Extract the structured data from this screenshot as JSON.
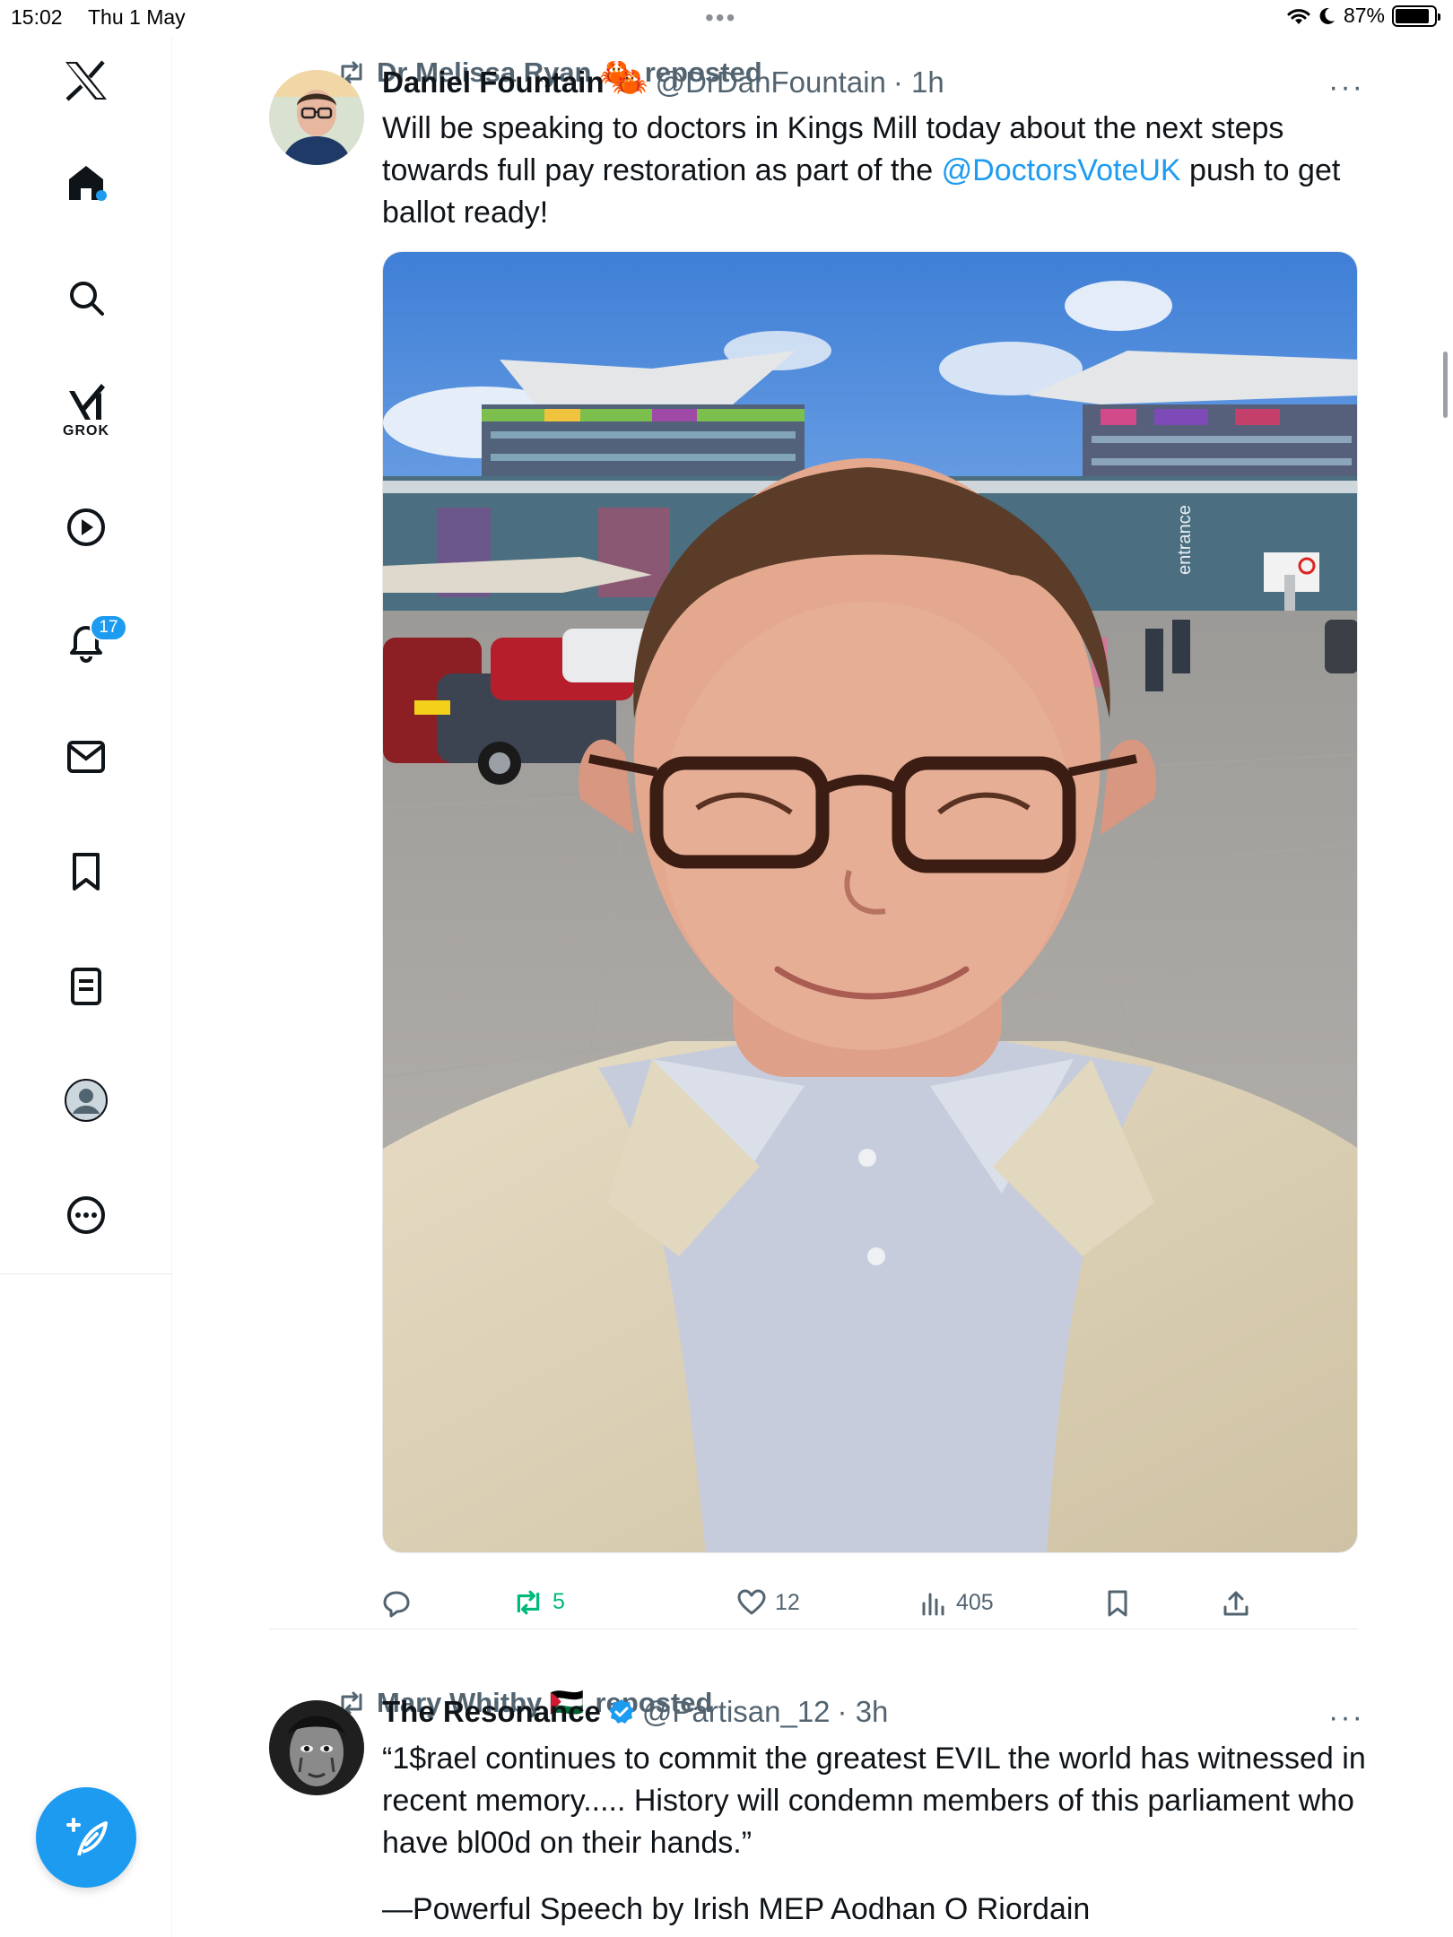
{
  "status_bar": {
    "time": "15:02",
    "date": "Thu 1 May",
    "battery": "87%",
    "battery_level": 0.87
  },
  "sidebar": {
    "items": [
      {
        "name": "home",
        "icon": "home-icon"
      },
      {
        "name": "explore",
        "icon": "search-icon"
      },
      {
        "name": "grok",
        "icon": "grok-icon",
        "label": "GROK"
      },
      {
        "name": "video",
        "icon": "play-icon"
      },
      {
        "name": "notifications",
        "icon": "bell-icon",
        "badge": "17"
      },
      {
        "name": "messages",
        "icon": "mail-icon"
      },
      {
        "name": "bookmarks",
        "icon": "bookmark-icon"
      },
      {
        "name": "lists",
        "icon": "list-icon"
      },
      {
        "name": "profile",
        "icon": "avatar-icon"
      },
      {
        "name": "more",
        "icon": "more-icon"
      }
    ],
    "compose_icon": "compose-icon"
  },
  "tweets": [
    {
      "repost_by": "Dr Melissa Ryan 🦀",
      "repost_suffix": "reposted",
      "name": "Daniel Fountain",
      "name_emoji": "🦀",
      "handle": "@DrDanFountain",
      "time": "· 1h",
      "text_1": "Will be speaking to doctors in Kings Mill today about the next steps towards full pay restoration as part of the ",
      "mention": "@DoctorsVoteUK",
      "text_2": " push to get ballot ready!",
      "more": "···",
      "actions": {
        "replies": "",
        "reposts": "5",
        "likes": "12",
        "views": "405"
      },
      "photo": {
        "building_sign": "entrance"
      }
    },
    {
      "repost_by": "Mary Whitby 🇵🇸",
      "repost_suffix": "reposted",
      "name": "The Resonance",
      "verified": true,
      "handle": "@Partisan_12",
      "time": "· 3h",
      "text_1": "“1$rael continues to commit the greatest EVIL the world has witnessed in recent memory..... History will condemn members of this parliament who have bl00d on their hands.”",
      "text_2": "—Powerful Speech by Irish MEP Aodhan O Riordain",
      "more": "···"
    }
  ],
  "colors": {
    "accent": "#1d9bf0",
    "repost_green": "#00ba7c",
    "muted": "#536471",
    "text": "#0f1419"
  }
}
